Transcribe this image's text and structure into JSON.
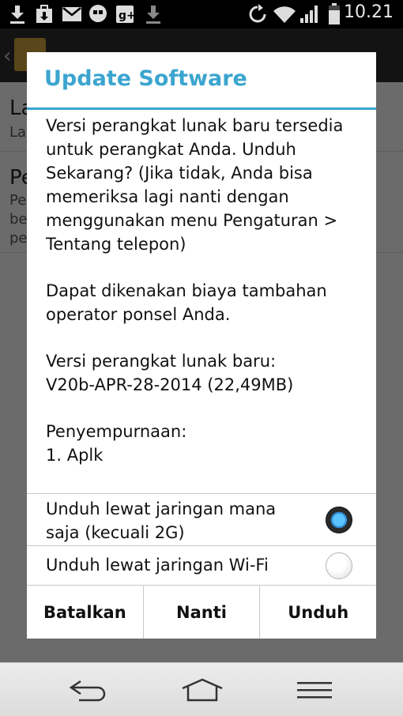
{
  "status_bar": {
    "time": "10.21",
    "left_icons": [
      "download-icon",
      "store-download-icon",
      "gmail-icon",
      "hangouts-icon",
      "google-plus-icon",
      "download-icon"
    ],
    "right_icons": [
      "sync-icon",
      "wifi-icon",
      "signal-icon",
      "battery-icon"
    ]
  },
  "background_app": {
    "rows": [
      {
        "title_fragment": "La",
        "subtitle_fragment": "La"
      },
      {
        "title_fragment": "Pe",
        "subtitle_fragment": [
          "Pe",
          "be",
          "pe"
        ]
      }
    ]
  },
  "dialog": {
    "title": "Update Software",
    "body": {
      "para1": "Versi perangkat lunak baru tersedia untuk perangkat Anda. Unduh Sekarang? (Jika tidak, Anda bisa memeriksa lagi nanti dengan menggunakan menu Pengaturan > Tentang telepon)",
      "para2": "Dapat dikenakan biaya tambahan operator ponsel Anda.",
      "para3_line1": "Versi perangkat lunak baru:",
      "para3_line2": "V20b-APR-28-2014 (22,49MB)",
      "para4_line1": "Penyempurnaan:",
      "para4_line2": "1. Aplk"
    },
    "options": [
      {
        "label": "Unduh lewat jaringan mana saja (kecuali 2G)",
        "selected": true
      },
      {
        "label": "Unduh lewat jaringan Wi-Fi",
        "selected": false
      }
    ],
    "buttons": {
      "cancel": "Batalkan",
      "later": "Nanti",
      "download": "Unduh"
    }
  },
  "colors": {
    "accent": "#3ba5cf",
    "radio_selected": "#2e8ad8"
  }
}
